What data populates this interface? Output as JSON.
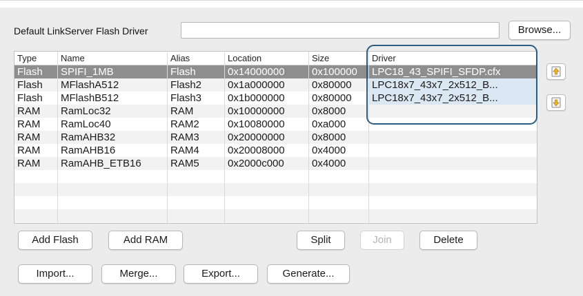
{
  "driver_field": {
    "label": "Default LinkServer Flash Driver",
    "value": "",
    "browse_label": "Browse..."
  },
  "table": {
    "columns": [
      "Type",
      "Name",
      "Alias",
      "Location",
      "Size",
      "Driver"
    ],
    "rows": [
      {
        "type": "Flash",
        "name": "SPIFI_1MB",
        "alias": "Flash",
        "location": "0x14000000",
        "size": "0x100000",
        "driver": "LPC18_43_SPIFI_SFDP.cfx"
      },
      {
        "type": "Flash",
        "name": "MFlashA512",
        "alias": "Flash2",
        "location": "0x1a000000",
        "size": "0x80000",
        "driver": "LPC18x7_43x7_2x512_B..."
      },
      {
        "type": "Flash",
        "name": "MFlashB512",
        "alias": "Flash3",
        "location": "0x1b000000",
        "size": "0x80000",
        "driver": "LPC18x7_43x7_2x512_B..."
      },
      {
        "type": "RAM",
        "name": "RamLoc32",
        "alias": "RAM",
        "location": "0x10000000",
        "size": "0x8000",
        "driver": ""
      },
      {
        "type": "RAM",
        "name": "RamLoc40",
        "alias": "RAM2",
        "location": "0x10080000",
        "size": "0xa000",
        "driver": ""
      },
      {
        "type": "RAM",
        "name": "RamAHB32",
        "alias": "RAM3",
        "location": "0x20000000",
        "size": "0x8000",
        "driver": ""
      },
      {
        "type": "RAM",
        "name": "RamAHB16",
        "alias": "RAM4",
        "location": "0x20008000",
        "size": "0x4000",
        "driver": ""
      },
      {
        "type": "RAM",
        "name": "RamAHB_ETB16",
        "alias": "RAM5",
        "location": "0x2000c000",
        "size": "0x4000",
        "driver": ""
      }
    ]
  },
  "buttons": {
    "add_flash": "Add Flash",
    "add_ram": "Add RAM",
    "split": "Split",
    "join": "Join",
    "delete": "Delete",
    "import": "Import...",
    "merge": "Merge...",
    "export": "Export...",
    "generate": "Generate..."
  },
  "icons": {
    "move_up": "move-up-icon",
    "move_down": "move-down-icon"
  },
  "colors": {
    "selected_row": "#8e8e8e",
    "driver_column_fill": "#dbe7f2",
    "highlight_outline": "#2b5c85"
  }
}
